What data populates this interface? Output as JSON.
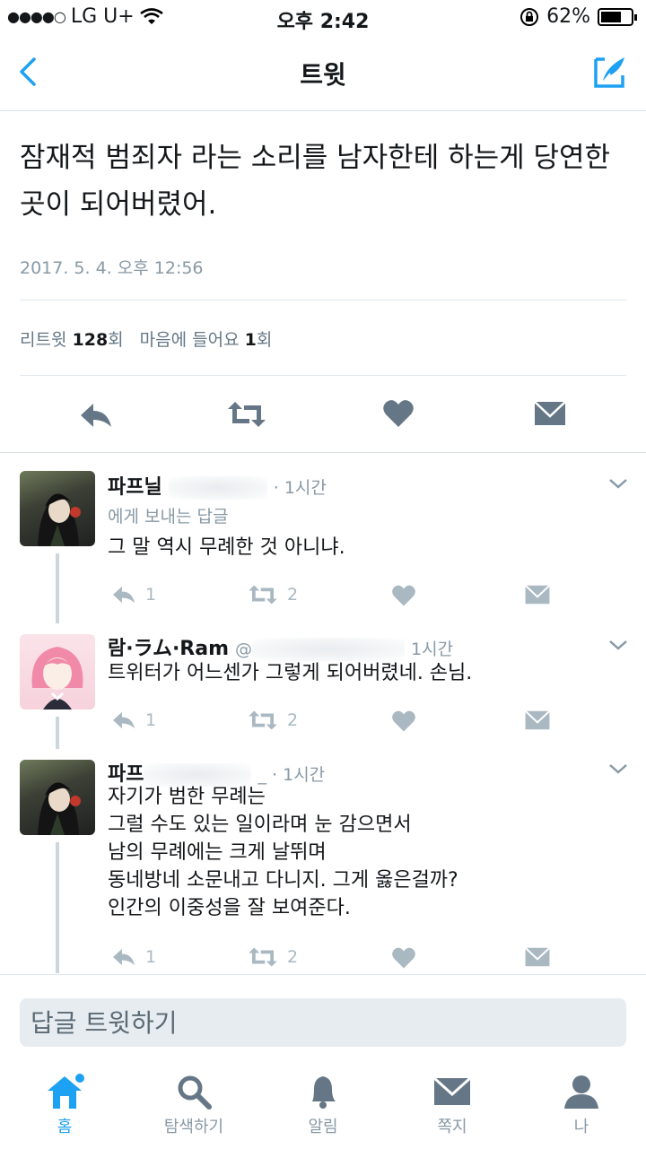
{
  "status": {
    "carrier": "LG U+",
    "time": "오후 2:42",
    "battery": "62%"
  },
  "nav": {
    "title": "트윗"
  },
  "tweet": {
    "text": "잠재적 범죄자 라는 소리를 남자한테 하는게 당연한 곳이 되어버렸어.",
    "time": "2017. 5. 4. 오후 12:56",
    "retweet_label": "리트윗",
    "retweet_count": "128",
    "retweet_unit": "회",
    "like_label": "마음에 들어요",
    "like_count": "1",
    "like_unit": "회"
  },
  "replies": [
    {
      "name": "파프닐",
      "meta": "· 1시간",
      "replying": "에게 보내는 답글",
      "text": "그 말 역시 무례한 것 아니냐.",
      "reply_count": "1",
      "retweet_count": "2"
    },
    {
      "name": "람·ラム·Ram",
      "handle": "@",
      "meta": "1시간",
      "text": "트위터가 어느센가 그렇게 되어버렸네. 손님.",
      "reply_count": "1",
      "retweet_count": "2"
    },
    {
      "name": "파프",
      "meta": "_ · 1시간",
      "text": "자기가 범한 무례는\n그럴 수도 있는 일이라며 눈 감으면서\n남의 무례에는 크게 날뛰며\n동네방네 소문내고 다니지. 그게 옳은걸까?\n인간의 이중성을 잘 보여준다.",
      "reply_count": "1",
      "retweet_count": "2"
    }
  ],
  "reply_input": {
    "placeholder": "답글 트윗하기"
  },
  "tabs": [
    {
      "label": "홈",
      "icon": "home-icon",
      "active": true
    },
    {
      "label": "탐색하기",
      "icon": "search-icon"
    },
    {
      "label": "알림",
      "icon": "bell-icon"
    },
    {
      "label": "쪽지",
      "icon": "envelope-icon"
    },
    {
      "label": "나",
      "icon": "person-icon"
    }
  ],
  "colors": {
    "accent": "#1da1f2",
    "muted": "#8899a6",
    "icon": "#aab8c2",
    "dark_icon": "#657786"
  }
}
